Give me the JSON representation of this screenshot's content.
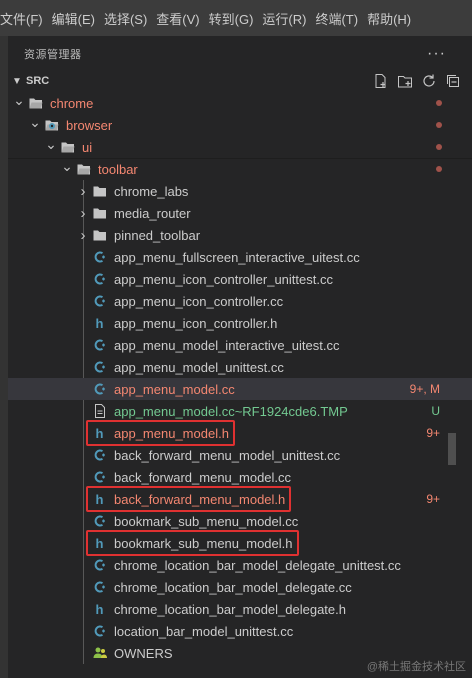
{
  "menubar": {
    "items": [
      "文件(F)",
      "编辑(E)",
      "选择(S)",
      "查看(V)",
      "转到(G)",
      "运行(R)",
      "终端(T)",
      "帮助(H)"
    ]
  },
  "explorer": {
    "title": "资源管理器",
    "more": "···",
    "section": "SRC",
    "actions": [
      "new-file-icon",
      "new-folder-icon",
      "refresh-icon",
      "collapse-all-icon"
    ]
  },
  "tree": [
    {
      "depth": 1,
      "type": "folder",
      "open": true,
      "name": "chrome",
      "style": "folder-error",
      "dot": true
    },
    {
      "depth": 2,
      "type": "folder-special",
      "open": true,
      "name": "browser",
      "style": "folder-error",
      "dot": true
    },
    {
      "depth": 3,
      "type": "folder",
      "open": true,
      "name": "ui",
      "style": "folder-error",
      "dot": true
    },
    {
      "depth": 4,
      "type": "folder",
      "open": true,
      "name": "toolbar",
      "style": "folder-error",
      "dot": true
    },
    {
      "depth": 5,
      "type": "folder",
      "open": false,
      "name": "chrome_labs"
    },
    {
      "depth": 5,
      "type": "folder",
      "open": false,
      "name": "media_router"
    },
    {
      "depth": 5,
      "type": "folder",
      "open": false,
      "name": "pinned_toolbar"
    },
    {
      "depth": 5,
      "type": "cc",
      "name": "app_menu_fullscreen_interactive_uitest.cc"
    },
    {
      "depth": 5,
      "type": "cc",
      "name": "app_menu_icon_controller_unittest.cc"
    },
    {
      "depth": 5,
      "type": "cc",
      "name": "app_menu_icon_controller.cc"
    },
    {
      "depth": 5,
      "type": "h",
      "name": "app_menu_icon_controller.h"
    },
    {
      "depth": 5,
      "type": "cc",
      "name": "app_menu_model_interactive_uitest.cc"
    },
    {
      "depth": 5,
      "type": "cc",
      "name": "app_menu_model_unittest.cc"
    },
    {
      "depth": 5,
      "type": "cc",
      "name": "app_menu_model.cc",
      "style": "error",
      "badge": "9+, M",
      "selected": true
    },
    {
      "depth": 5,
      "type": "tmp",
      "name": "app_menu_model.cc~RF1924cde6.TMP",
      "style": "untracked",
      "badge": "U",
      "badgeStyle": "u"
    },
    {
      "depth": 5,
      "type": "h",
      "name": "app_menu_model.h",
      "style": "error",
      "badge": "9+"
    },
    {
      "depth": 5,
      "type": "cc",
      "name": "back_forward_menu_model_unittest.cc"
    },
    {
      "depth": 5,
      "type": "cc",
      "name": "back_forward_menu_model.cc"
    },
    {
      "depth": 5,
      "type": "h",
      "name": "back_forward_menu_model.h",
      "style": "error",
      "badge": "9+"
    },
    {
      "depth": 5,
      "type": "cc",
      "name": "bookmark_sub_menu_model.cc"
    },
    {
      "depth": 5,
      "type": "h",
      "name": "bookmark_sub_menu_model.h"
    },
    {
      "depth": 5,
      "type": "cc",
      "name": "chrome_location_bar_model_delegate_unittest.cc"
    },
    {
      "depth": 5,
      "type": "cc",
      "name": "chrome_location_bar_model_delegate.cc"
    },
    {
      "depth": 5,
      "type": "h",
      "name": "chrome_location_bar_model_delegate.h"
    },
    {
      "depth": 5,
      "type": "cc",
      "name": "location_bar_model_unittest.cc"
    },
    {
      "depth": 5,
      "type": "owners",
      "name": "OWNERS"
    }
  ],
  "highlighted": [
    "app_menu_model.h",
    "back_forward_menu_model.h",
    "bookmark_sub_menu_model.h"
  ],
  "watermark": "@稀土掘金技术社区",
  "colors": {
    "cc_icon": "#519aba",
    "h_icon": "#519aba",
    "folder": "#c5c5c5",
    "error": "#f48771",
    "untracked": "#73c991",
    "highlight_box": "#e03131"
  }
}
